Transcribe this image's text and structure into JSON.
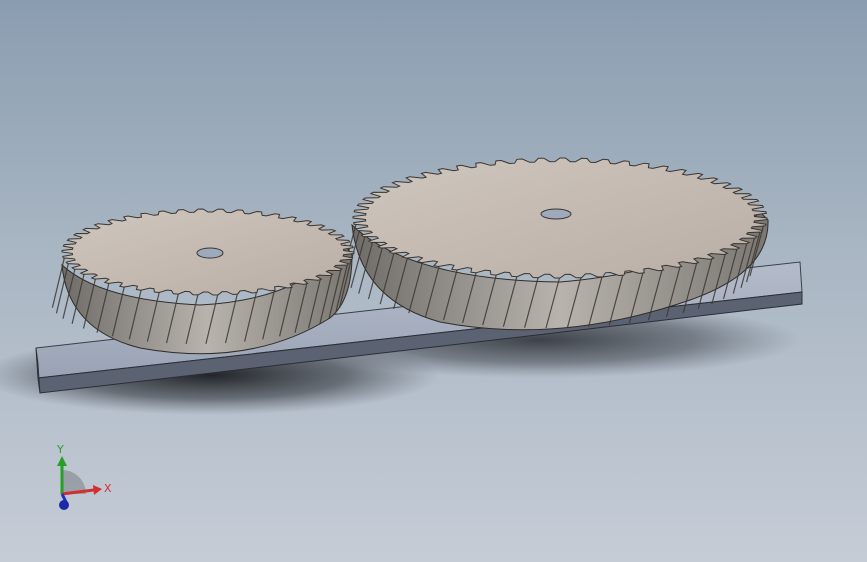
{
  "viewport": {
    "background_top": "#8a9db0",
    "background_bottom": "#c5ccd6"
  },
  "model": {
    "parts": [
      "small-helical-gear",
      "large-helical-gear",
      "base-plate"
    ],
    "gear_face_color": "#c2b8b0",
    "gear_teeth_color": "#8a8680",
    "plate_color": "#9aa3b5"
  },
  "triad": {
    "x_label": "X",
    "y_label": "Y",
    "x_color": "#d03030",
    "y_color": "#28a028",
    "z_color": "#2030c0"
  }
}
